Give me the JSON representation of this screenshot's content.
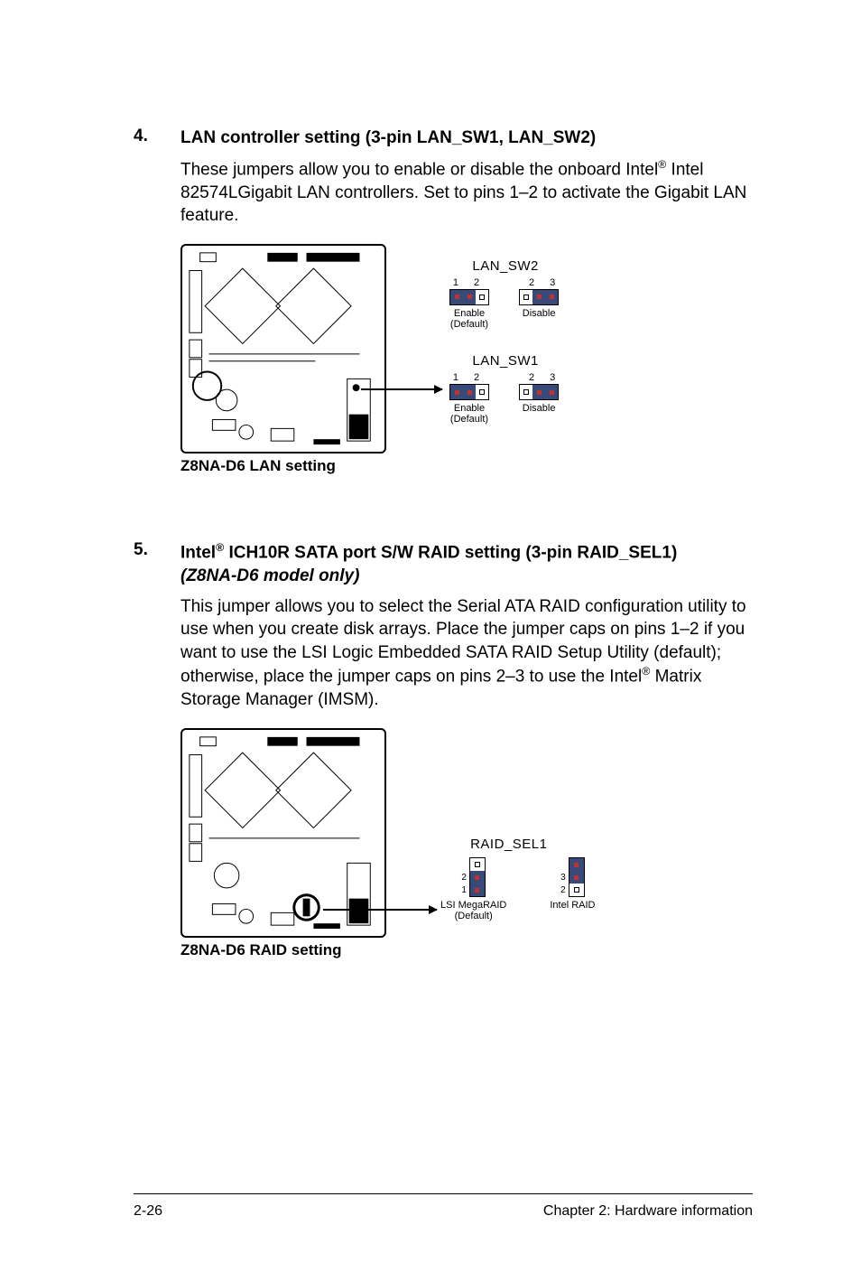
{
  "sections": [
    {
      "number": "4.",
      "heading_pre": "LAN controller setting (3-pin LAN_SW1, LAN_SW2)",
      "body_pre": "These jumpers allow you to enable or disable the onboard Intel",
      "body_post": " Intel 82574LGigabit LAN controllers. Set to pins 1–2 to activate the Gigabit LAN feature.",
      "diagram_caption": "Z8NA-D6 LAN setting",
      "jumper_groups": [
        {
          "label": "LAN_SW2",
          "left_nums": "1  2",
          "right_nums": "2  3",
          "left_caption": "Enable",
          "left_caption2": "(Default)",
          "right_caption": "Disable"
        },
        {
          "label": "LAN_SW1",
          "left_nums": "1  2",
          "right_nums": "2  3",
          "left_caption": "Enable",
          "left_caption2": "(Default)",
          "right_caption": "Disable"
        }
      ]
    },
    {
      "number": "5.",
      "heading_pre": "Intel",
      "heading_post": " ICH10R SATA port S/W RAID setting (3-pin RAID_SEL1)",
      "heading_line2": "(Z8NA-D6 model only)",
      "body_pre": "This jumper allows you to select the Serial ATA RAID configuration utility to use when you create disk arrays. Place the jumper caps on pins 1–2 if you want to use the LSI Logic Embedded SATA RAID Setup Utility (default); otherwise, place the jumper caps on pins 2–3 to use the Intel",
      "body_post": " Matrix Storage Manager (IMSM).",
      "diagram_caption": "Z8NA-D6 RAID setting",
      "raid_label": "RAID_SEL1",
      "raid_left_caption": "LSI MegaRAID",
      "raid_left_caption2": "(Default)",
      "raid_right_caption": "Intel RAID",
      "raid_nums": [
        "3",
        "2",
        "1"
      ],
      "raid_nums_r": [
        "3",
        "2",
        "1"
      ]
    }
  ],
  "footer": {
    "left": "2-26",
    "right": "Chapter 2: Hardware information"
  }
}
